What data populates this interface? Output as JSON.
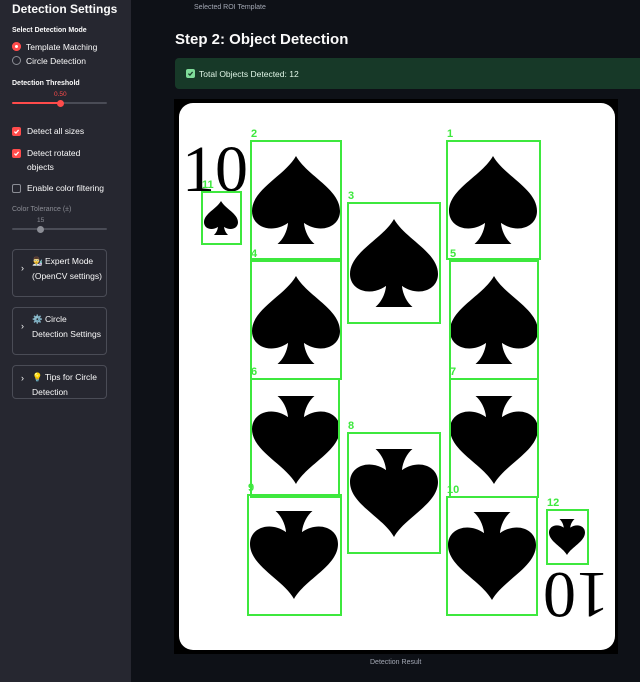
{
  "sidebar": {
    "title": "Detection Settings",
    "mode_label": "Select Detection Mode",
    "modes": [
      {
        "label": "Template Matching",
        "selected": true
      },
      {
        "label": "Circle Detection",
        "selected": false
      }
    ],
    "threshold": {
      "label": "Detection Threshold",
      "value_text": "0.50",
      "value": 0.5
    },
    "checkboxes": [
      {
        "label": "Detect all sizes",
        "checked": true
      },
      {
        "label": "Detect rotated objects",
        "checked": true
      },
      {
        "label": "Enable color filtering",
        "checked": false
      }
    ],
    "color_tolerance": {
      "label": "Color Tolerance (±)",
      "value_text": "15",
      "value": 0.27
    },
    "expanders": [
      {
        "icon": "👨‍🔬",
        "label": "Expert Mode (OpenCV settings)"
      },
      {
        "icon": "⚙️",
        "label": "Circle Detection Settings"
      },
      {
        "icon": "💡",
        "label": "Tips for Circle Detection"
      }
    ]
  },
  "main": {
    "roi_caption": "Selected ROI Template",
    "step_title": "Step 2: Object Detection",
    "success_text": "Total Objects Detected: 12",
    "result_caption": "Detection Result",
    "card": {
      "rank_top": "10",
      "rank_bottom": "10",
      "detections": [
        {
          "label": "1"
        },
        {
          "label": "2"
        },
        {
          "label": "3"
        },
        {
          "label": "4"
        },
        {
          "label": "5"
        },
        {
          "label": "6"
        },
        {
          "label": "7"
        },
        {
          "label": "8"
        },
        {
          "label": "9"
        },
        {
          "label": "10"
        },
        {
          "label": "11"
        },
        {
          "label": "12"
        }
      ]
    }
  },
  "colors": {
    "accent": "#ff4b4b",
    "detection_box": "#3ee83e",
    "success_bg": "#173928"
  }
}
